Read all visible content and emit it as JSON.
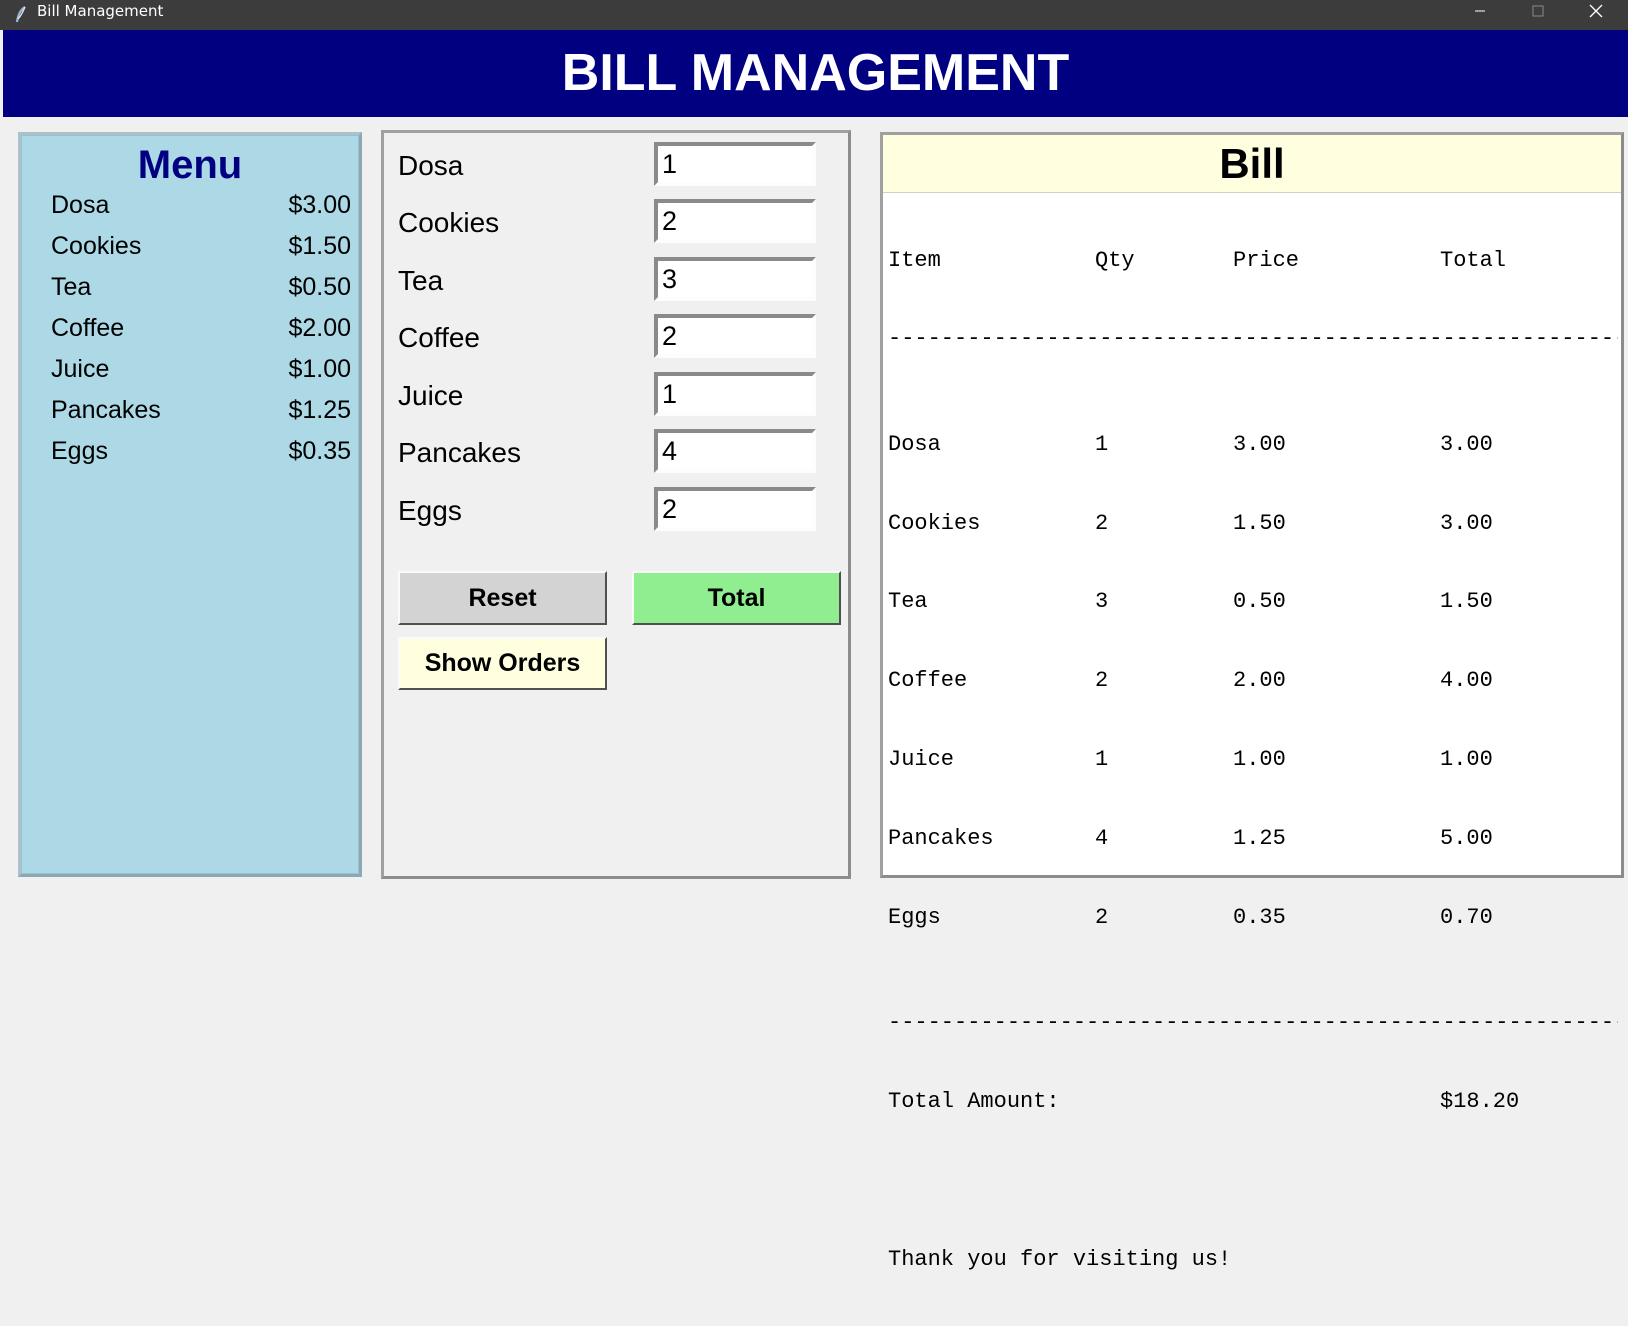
{
  "window": {
    "title": "Bill Management"
  },
  "header": {
    "title": "BILL MANAGEMENT"
  },
  "menu": {
    "title": "Menu",
    "items": [
      {
        "name": "Dosa",
        "price": "$3.00"
      },
      {
        "name": "Cookies",
        "price": "$1.50"
      },
      {
        "name": "Tea",
        "price": "$0.50"
      },
      {
        "name": "Coffee",
        "price": "$2.00"
      },
      {
        "name": "Juice",
        "price": "$1.00"
      },
      {
        "name": "Pancakes",
        "price": "$1.25"
      },
      {
        "name": "Eggs",
        "price": "$0.35"
      }
    ]
  },
  "order": {
    "rows": [
      {
        "label": "Dosa",
        "qty": "1"
      },
      {
        "label": "Cookies",
        "qty": "2"
      },
      {
        "label": "Tea",
        "qty": "3"
      },
      {
        "label": "Coffee",
        "qty": "2"
      },
      {
        "label": "Juice",
        "qty": "1"
      },
      {
        "label": "Pancakes",
        "qty": "4"
      },
      {
        "label": "Eggs",
        "qty": "2"
      }
    ],
    "reset_label": "Reset",
    "total_label": "Total",
    "show_orders_label": "Show Orders"
  },
  "bill": {
    "title": "Bill",
    "columns": [
      "Item",
      "Qty",
      "Price",
      "Total"
    ],
    "separator": "------------------------------------------------------------",
    "rows": [
      [
        "Dosa",
        "1",
        "3.00",
        "3.00"
      ],
      [
        "Cookies",
        "2",
        "1.50",
        "3.00"
      ],
      [
        "Tea",
        "3",
        "0.50",
        "1.50"
      ],
      [
        "Coffee",
        "2",
        "2.00",
        "4.00"
      ],
      [
        "Juice",
        "1",
        "1.00",
        "1.00"
      ],
      [
        "Pancakes",
        "4",
        "1.25",
        "5.00"
      ],
      [
        "Eggs",
        "2",
        "0.35",
        "0.70"
      ]
    ],
    "total_label": "Total Amount:",
    "total_value": "$18.20",
    "thanks": "Thank you for visiting us!"
  },
  "colors": {
    "header_bg": "#000080",
    "menu_bg": "#add8e6",
    "menu_title": "#000080",
    "reset_bg": "#d3d3d3",
    "total_bg": "#90ee90",
    "show_orders_bg": "#ffffe0",
    "bill_header_bg": "#ffffe0"
  },
  "icons": [
    "feather-icon",
    "minimize-icon",
    "maximize-icon",
    "close-icon"
  ]
}
